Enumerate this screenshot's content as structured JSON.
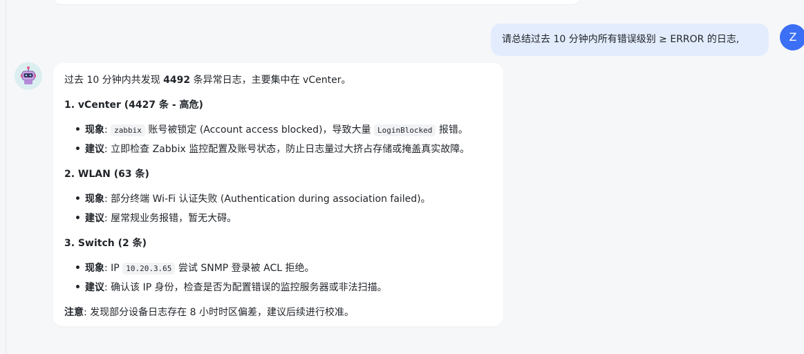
{
  "user_message": {
    "text": "请总结过去 10 分钟内所有错误级别 ≥ ERROR 的日志,",
    "avatar_initial": "Z"
  },
  "assistant": {
    "intro_prefix": "过去 10 分钟内共发现 ",
    "intro_count": "4492",
    "intro_suffix": " 条异常日志，主要集中在 vCenter。",
    "sections": [
      {
        "heading": "1. vCenter (4427 条 - 高危)",
        "items": [
          {
            "label": "现象",
            "sep": ": ",
            "code1": "zabbix",
            "text1": " 账号被锁定 (Account access blocked)，导致大量 ",
            "code2": "LoginBlocked",
            "text2": " 报错。"
          },
          {
            "label": "建议",
            "sep": ": ",
            "text": "立即检查 Zabbix 监控配置及账号状态，防止日志量过大挤占存储或掩盖真实故障。"
          }
        ]
      },
      {
        "heading": "2. WLAN (63 条)",
        "items": [
          {
            "label": "现象",
            "sep": ": ",
            "text": "部分终端 Wi-Fi 认证失败 (Authentication during association failed)。"
          },
          {
            "label": "建议",
            "sep": ": ",
            "text": "屋常规业务报错，暂无大碍。"
          }
        ]
      },
      {
        "heading": "3. Switch (2 条)",
        "items": [
          {
            "label": "现象",
            "sep": ": ",
            "text1": "IP ",
            "code1": "10.20.3.65",
            "text2": " 尝试 SNMP 登录被 ACL 拒绝。"
          },
          {
            "label": "建议",
            "sep": ": ",
            "text": "确认该 IP 身份，检查是否为配置错误的监控服务器或非法扫描。"
          }
        ]
      }
    ],
    "note_label": "注意",
    "note_sep": ": ",
    "note_text": "发现部分设备日志存在 8 小时时区偏差，建议后续进行校准。"
  },
  "colors": {
    "background": "#f6f7f9",
    "user_bubble": "#e3ecfd",
    "user_avatar": "#3b6ff5",
    "card": "#ffffff",
    "code_bg": "#f1f2f4"
  },
  "icons": {
    "assistant_avatar": "robot-icon"
  }
}
